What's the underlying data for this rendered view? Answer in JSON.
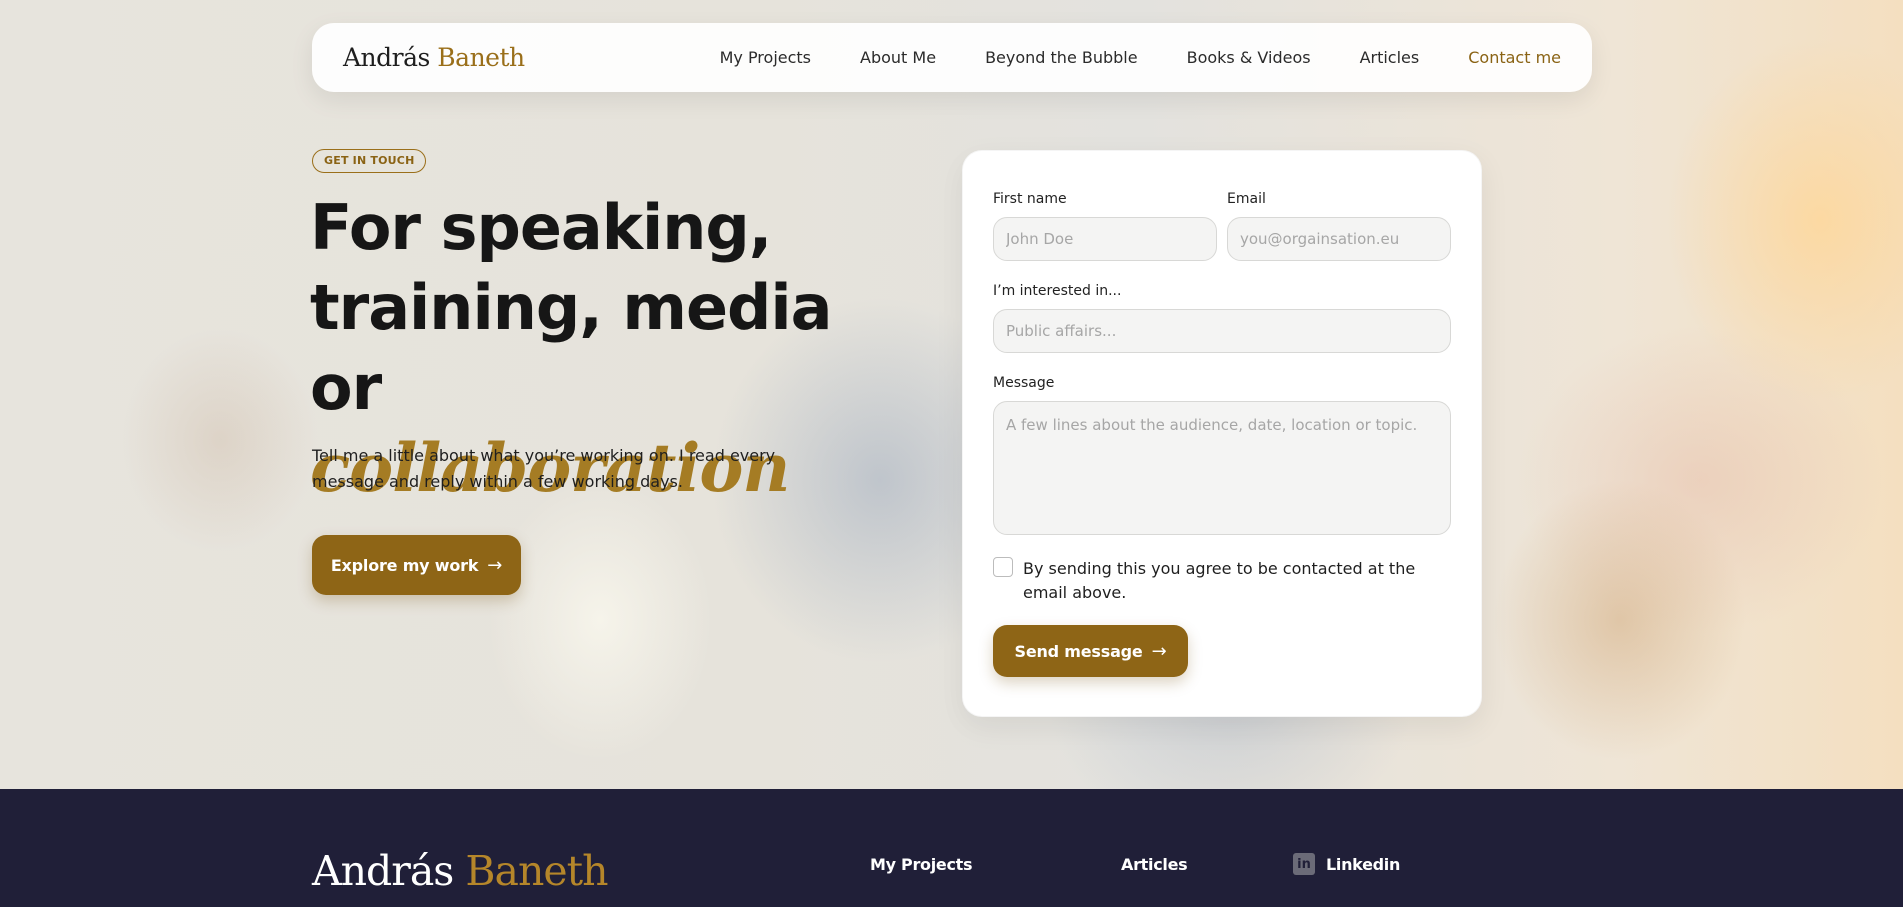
{
  "nav": {
    "brand_first": "András",
    "brand_last": "Baneth",
    "links": [
      {
        "label": "My Projects"
      },
      {
        "label": "About Me"
      },
      {
        "label": "Beyond the Bubble"
      },
      {
        "label": "Books & Videos"
      },
      {
        "label": "Articles"
      },
      {
        "label": "Contact me"
      }
    ]
  },
  "hero": {
    "badge": "GET IN TOUCH",
    "headline_line1": "For speaking,",
    "headline_line2": "training, media",
    "headline_line3_prefix": "or ",
    "headline_accent": "collaboration",
    "lead": "Tell me a little about what you’re working on. I read every message and reply within a few working days.",
    "cta_label": "Explore my work",
    "cta_icon": "arrow-right-icon"
  },
  "form": {
    "first_name_label": "First name",
    "first_name_placeholder": "John Doe",
    "first_name_value": "",
    "email_label": "Email",
    "email_placeholder": "you@orgainsation.eu",
    "email_value": "",
    "interest_label": "I’m interested in...",
    "interest_placeholder": "Public affairs...",
    "interest_value": "",
    "message_label": "Message",
    "message_placeholder": "A few lines about the audience, date, location or topic.",
    "message_value": "",
    "consent_checked": false,
    "consent_text": "By sending this you agree to be contacted at the email above.",
    "send_label": "Send message",
    "send_icon": "arrow-right-icon"
  },
  "footer": {
    "brand_first": "András",
    "brand_last": "Baneth",
    "links": [
      {
        "label": "My Projects"
      },
      {
        "label": "Articles"
      },
      {
        "label": "Linkedin",
        "icon": "linkedin-icon"
      }
    ]
  },
  "colors": {
    "accent": "#8e6516",
    "accent_text": "#a57c24",
    "footer_bg": "#201f38"
  }
}
